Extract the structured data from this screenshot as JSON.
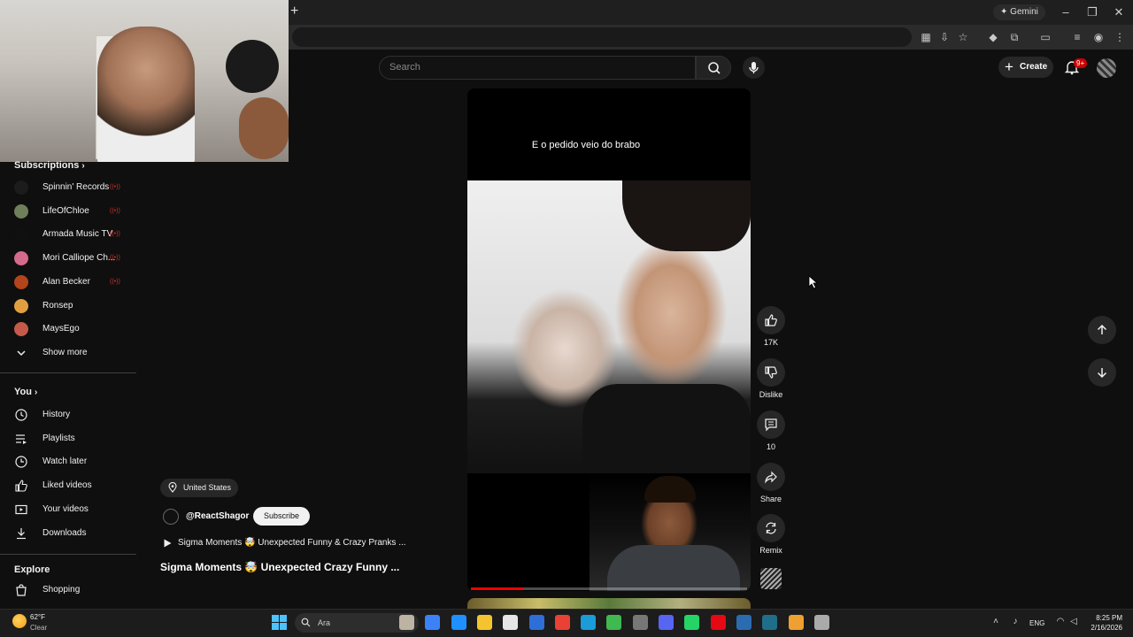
{
  "browser": {
    "new_tab_glyph": "+",
    "gemini_label": "Gemini",
    "window_controls": [
      "–",
      "❐",
      "✕"
    ]
  },
  "header": {
    "search_placeholder": "Search",
    "create_label": "Create",
    "notification_badge": "9+"
  },
  "sidebar": {
    "subscriptions_title": "Subscriptions",
    "subscriptions": [
      {
        "label": "Spinnin' Records",
        "live": true,
        "avatar_color": "#1c1c1c"
      },
      {
        "label": "LifeOfChloe",
        "live": true,
        "avatar_color": "#6f7f5a"
      },
      {
        "label": "Armada Music TV",
        "live": true,
        "avatar_color": "#101010"
      },
      {
        "label": "Mori Calliope Ch...",
        "live": true,
        "avatar_color": "#d46a8c"
      },
      {
        "label": "Alan Becker",
        "live": true,
        "avatar_color": "#b2451b"
      },
      {
        "label": "Ronsep",
        "live": false,
        "avatar_color": "#e0a040"
      },
      {
        "label": "MaysEgo",
        "live": false,
        "avatar_color": "#c45a4a"
      }
    ],
    "live_glyph": "((•))",
    "show_more": "Show more",
    "you_title": "You",
    "you_items": [
      {
        "label": "History",
        "icon": "history-icon"
      },
      {
        "label": "Playlists",
        "icon": "playlists-icon"
      },
      {
        "label": "Watch later",
        "icon": "watch-later-icon"
      },
      {
        "label": "Liked videos",
        "icon": "liked-videos-icon"
      },
      {
        "label": "Your videos",
        "icon": "your-videos-icon"
      },
      {
        "label": "Downloads",
        "icon": "downloads-icon"
      }
    ],
    "explore_title": "Explore",
    "explore_items": [
      {
        "label": "Shopping",
        "icon": "shopping-icon"
      }
    ]
  },
  "short": {
    "caption": "E o pedido veio do brabo",
    "progress": 0.19,
    "location": "United States",
    "channel": "@ReactShagor",
    "subscribe_label": "Subscribe",
    "playlist_title": "Sigma Moments 🤯 Unexpected Funny & Crazy Pranks ...",
    "title": "Sigma Moments 🤯 Unexpected Crazy Funny ..."
  },
  "actions": {
    "likes": "17K",
    "dislike": "Dislike",
    "comments": "10",
    "share": "Share",
    "remix": "Remix"
  },
  "taskbar": {
    "weather_temp": "62°F",
    "weather_cond": "Clear",
    "search_text": "Ara",
    "lang": "ENG",
    "time": "8:25 PM",
    "date": "2/16/2026",
    "app_colors": [
      "#bdb3a3",
      "#3b82f6",
      "#1e90ff",
      "#f4c430",
      "#e6e6e6",
      "#2d6fd6",
      "#e94235",
      "#1b9bd8",
      "#3fb950",
      "#777777",
      "#5865f2",
      "#25d366",
      "#e50914",
      "#2b6cb0",
      "#1f6f8b",
      "#f0a030",
      "#aaaaaa"
    ]
  }
}
